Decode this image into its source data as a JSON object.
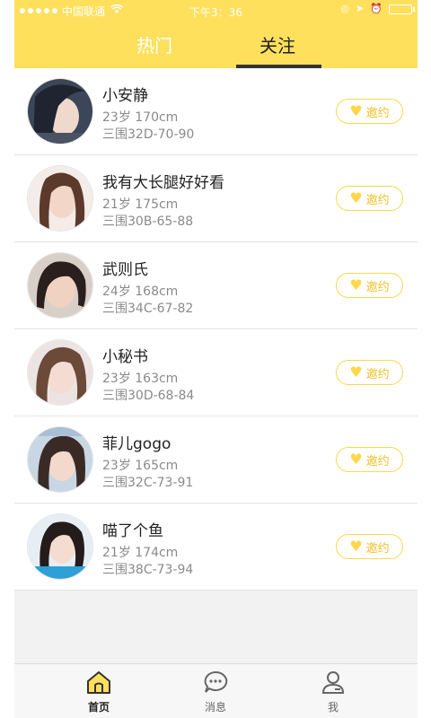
{
  "status_bar": {
    "carrier": "中国联通",
    "time": "下午3：36"
  },
  "tabs": [
    {
      "label": "热门"
    },
    {
      "label": "关注"
    }
  ],
  "users": [
    {
      "name": "小安静",
      "age_height": "23岁 170cm",
      "measurements": "三围32D-70-90",
      "invite_label": "邀约"
    },
    {
      "name": "我有大长腿好好看",
      "age_height": "21岁 175cm",
      "measurements": "三围30B-65-88",
      "invite_label": "邀约"
    },
    {
      "name": "武则氏",
      "age_height": "24岁 168cm",
      "measurements": "三围34C-67-82",
      "invite_label": "邀约"
    },
    {
      "name": "小秘书",
      "age_height": "23岁 163cm",
      "measurements": "三围30D-68-84",
      "invite_label": "邀约"
    },
    {
      "name": "菲儿gogo",
      "age_height": "23岁 165cm",
      "measurements": "三围32C-73-91",
      "invite_label": "邀约"
    },
    {
      "name": "喵了个鱼",
      "age_height": "21岁 174cm",
      "measurements": "三围38C-73-94",
      "invite_label": "邀约"
    }
  ],
  "bottom_nav": [
    {
      "label": "首页",
      "icon": "home-icon"
    },
    {
      "label": "消息",
      "icon": "message-icon"
    },
    {
      "label": "我",
      "icon": "user-icon"
    }
  ],
  "colors": {
    "accent": "#fee05d",
    "invite_border": "#fed74a",
    "background": "#f2f2f2"
  }
}
